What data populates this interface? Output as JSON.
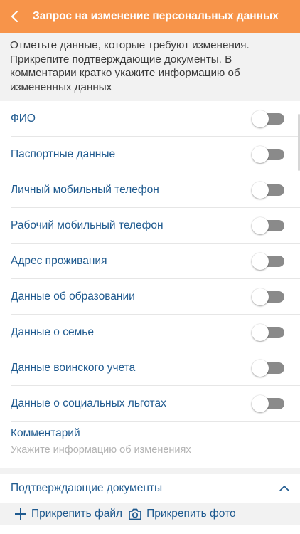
{
  "header": {
    "title": "Запрос на изменение персональных данных",
    "back_icon": "chevron-left-icon",
    "color": "#f7944a"
  },
  "intro": {
    "text": "Отметьте данные, которые требуют изменения. Прикрепите подтверждающие документы. В комментарии кратко укажите информацию об измененных данных"
  },
  "items": [
    {
      "label": "ФИО",
      "checked": false
    },
    {
      "label": "Паспортные данные",
      "checked": false
    },
    {
      "label": "Личный мобильный телефон",
      "checked": false
    },
    {
      "label": "Рабочий мобильный телефон",
      "checked": false
    },
    {
      "label": "Адрес проживания",
      "checked": false
    },
    {
      "label": "Данные об образовании",
      "checked": false
    },
    {
      "label": "Данные о семье",
      "checked": false
    },
    {
      "label": "Данные воинского учета",
      "checked": false
    },
    {
      "label": "Данные о социальных льготах",
      "checked": false
    }
  ],
  "comment": {
    "label": "Комментарий",
    "value": "",
    "placeholder": "Укажите информацию об изменениях"
  },
  "documents": {
    "title": "Подтверждающие документы",
    "expanded": true,
    "attach_file_label": "Прикрепить файл",
    "attach_photo_label": "Прикрепить фото",
    "attach_file_icon": "plus-icon",
    "attach_photo_icon": "camera-icon"
  },
  "colors": {
    "accent": "#f7944a",
    "label": "#1f5a8f",
    "switch_off_track": "#8a8a8a"
  }
}
